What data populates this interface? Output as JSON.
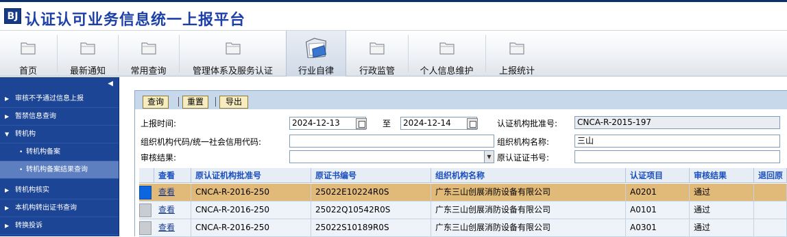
{
  "app": {
    "logo_text": "BJ",
    "title": "认证认可业务信息统一上报平台"
  },
  "toolbar": {
    "items": [
      {
        "label": "首页",
        "icon": "folder-icon"
      },
      {
        "label": "最新通知",
        "icon": "folder-icon"
      },
      {
        "label": "常用查询",
        "icon": "folder-icon"
      },
      {
        "label": "管理体系及服务认证",
        "icon": "folder-icon"
      },
      {
        "label": "行业自律",
        "icon": "open-folder-icon",
        "active": true
      },
      {
        "label": "行政监管",
        "icon": "folder-icon"
      },
      {
        "label": "个人信息维护",
        "icon": "folder-icon"
      },
      {
        "label": "上报统计",
        "icon": "folder-icon"
      }
    ]
  },
  "sidebar": {
    "collapse_glyph": "◀",
    "items": [
      {
        "label": "审核不予通过信息上报",
        "glyph": "▶"
      },
      {
        "label": "暂禁信息查询",
        "glyph": "▶"
      },
      {
        "label": "转机构",
        "glyph": "▼"
      },
      {
        "label": "转机构备案",
        "glyph": "•"
      },
      {
        "label": "转机构备案结果查询",
        "glyph": "•",
        "selected": true
      },
      {
        "label": "转机构核实",
        "glyph": "▶"
      },
      {
        "label": "本机构转出证书查询",
        "glyph": "▶"
      },
      {
        "label": "转换投诉",
        "glyph": "▶"
      }
    ]
  },
  "buttons": {
    "query": "查询",
    "reset": "重置",
    "export": "导出"
  },
  "form": {
    "report_time_label": "上报时间:",
    "date_from": "2024-12-13",
    "to_label": "至",
    "date_to": "2024-12-14",
    "approval_no_label": "认证机构批准号:",
    "approval_no_value": "CNCA-R-2015-197",
    "org_code_label": "组织机构代码/统一社会信用代码:",
    "org_code_value": "",
    "org_name_label": "组织机构名称:",
    "org_name_value": "三山",
    "review_result_label": "审核结果:",
    "review_result_value": "",
    "orig_cert_label": "原认证证书号:",
    "orig_cert_value": ""
  },
  "grid": {
    "columns": [
      "查看",
      "原认证机构批准号",
      "原证书编号",
      "组织机构名称",
      "认证项目",
      "审核结果",
      "退回原"
    ],
    "rows": [
      {
        "view": "查看",
        "orig_approval": "CNCA-R-2016-250",
        "orig_cert": "25022E10224R0S",
        "org": "广东三山创展消防设备有限公司",
        "project": "A0201",
        "result": "通过"
      },
      {
        "view": "查看",
        "orig_approval": "CNCA-R-2016-250",
        "orig_cert": "25022Q10542R0S",
        "org": "广东三山创展消防设备有限公司",
        "project": "A0101",
        "result": "通过"
      },
      {
        "view": "查看",
        "orig_approval": "CNCA-R-2016-250",
        "orig_cert": "25022S10189R0S",
        "org": "广东三山创展消防设备有限公司",
        "project": "A0301",
        "result": "通过"
      }
    ]
  }
}
